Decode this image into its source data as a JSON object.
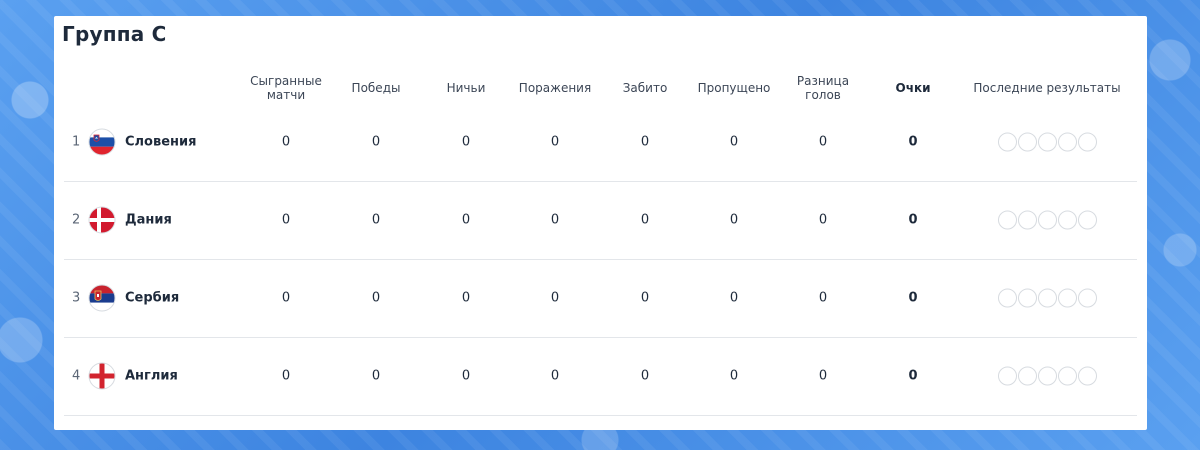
{
  "group": {
    "title": "Группа С"
  },
  "columns": {
    "played": "Сыгранные\nматчи",
    "wins": "Победы",
    "draws": "Ничьи",
    "losses": "Поражения",
    "scored": "Забито",
    "conceded": "Пропущено",
    "diff": "Разница\nголов",
    "points": "Очки",
    "recent": "Последние результаты"
  },
  "rows": [
    {
      "rank": "1",
      "team": "Словения",
      "flag": "slovenia-flag-icon",
      "played": "0",
      "wins": "0",
      "draws": "0",
      "losses": "0",
      "scored": "0",
      "conceded": "0",
      "diff": "0",
      "points": "0"
    },
    {
      "rank": "2",
      "team": "Дания",
      "flag": "denmark-flag-icon",
      "played": "0",
      "wins": "0",
      "draws": "0",
      "losses": "0",
      "scored": "0",
      "conceded": "0",
      "diff": "0",
      "points": "0"
    },
    {
      "rank": "3",
      "team": "Сербия",
      "flag": "serbia-flag-icon",
      "played": "0",
      "wins": "0",
      "draws": "0",
      "losses": "0",
      "scored": "0",
      "conceded": "0",
      "diff": "0",
      "points": "0"
    },
    {
      "rank": "4",
      "team": "Англия",
      "flag": "england-flag-icon",
      "played": "0",
      "wins": "0",
      "draws": "0",
      "losses": "0",
      "scored": "0",
      "conceded": "0",
      "diff": "0",
      "points": "0"
    }
  ],
  "colors": {
    "background": "#4a90e6",
    "card": "#ffffff",
    "text": "#1e2a3b",
    "divider": "#e3e6ea"
  }
}
